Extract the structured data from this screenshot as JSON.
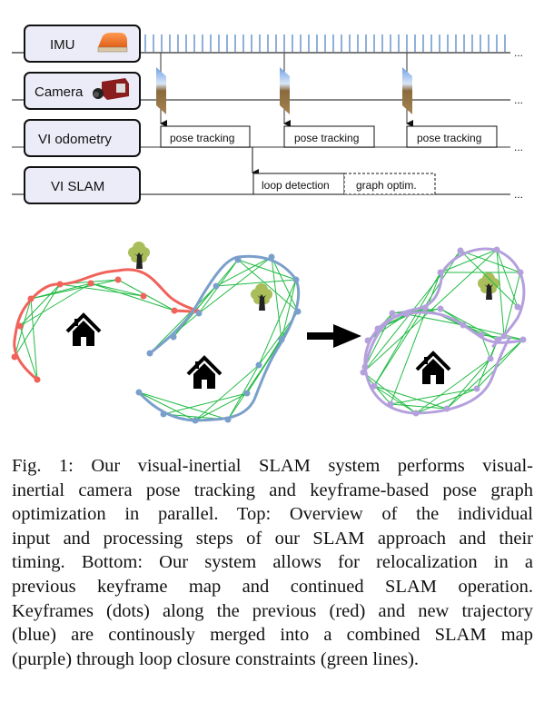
{
  "figure": {
    "timing_diagram": {
      "rows": [
        {
          "label": "IMU",
          "icon": "imu-sensor-icon"
        },
        {
          "label": "Camera",
          "icon": "camera-icon"
        },
        {
          "label": "VI odometry"
        },
        {
          "label": "VI SLAM"
        }
      ],
      "imu_tick_count": 45,
      "camera_frame_count": 3,
      "odometry_blocks": [
        "pose tracking",
        "pose tracking",
        "pose tracking"
      ],
      "slam_blocks": [
        {
          "label": "loop detection",
          "style": "solid"
        },
        {
          "label": "graph optim.",
          "style": "dashed"
        }
      ],
      "continuation": "..."
    },
    "trajectory_illustration": {
      "panels": [
        {
          "name": "previous-and-new-trajectory",
          "trajectories": [
            "red",
            "blue"
          ]
        },
        {
          "name": "merged-slam-map",
          "trajectories": [
            "purple"
          ]
        }
      ],
      "colors": {
        "previous_trajectory": "#f0625a",
        "new_trajectory": "#7a9fcb",
        "merged_map": "#b4a0dc",
        "loop_closure": "#22bb44",
        "tree": "#a9bd5a",
        "house": "#000000"
      },
      "landmarks": [
        "house",
        "tree"
      ]
    },
    "caption_lines": [
      "Fig. 1: Our visual-inertial SLAM system performs visual-",
      "inertial camera pose tracking and keyframe-based pose graph",
      "optimization in parallel. Top: Overview of the individual",
      "input and processing steps of our SLAM approach and their",
      "timing. Bottom: Our system allows for relocalization in a",
      "previous keyframe map and continued SLAM operation.",
      "Keyframes (dots) along the previous (red) and new trajectory",
      "(blue) are continously merged into a combined SLAM map",
      "(purple) through loop closure constraints (green lines)."
    ]
  }
}
